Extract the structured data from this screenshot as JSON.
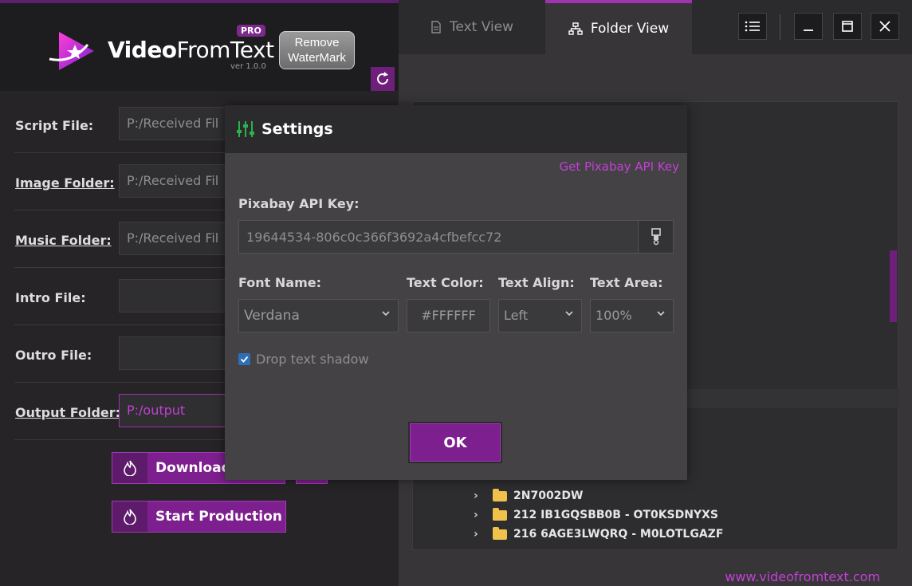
{
  "brand": {
    "name_bold": "Video",
    "name_rest": "FromText",
    "badge": "PRO",
    "version": "ver 1.0.0",
    "remove_watermark_line1": "Remove",
    "remove_watermark_line2": "WaterMark"
  },
  "form": {
    "script_file": {
      "label": "Script File:",
      "value": "P:/Received Fil"
    },
    "image_folder": {
      "label": "Image Folder:",
      "value": "P:/Received Fil"
    },
    "music_folder": {
      "label": "Music Folder:",
      "value": "P:/Received Fil"
    },
    "intro_file": {
      "label": "Intro File:",
      "value": ""
    },
    "outro_file": {
      "label": "Outro File:",
      "value": ""
    },
    "output_folder": {
      "label": "Output Folder:",
      "value": "P:/output"
    }
  },
  "actions": {
    "download": "Download",
    "start_production": "Start Production"
  },
  "tabs": [
    {
      "label": "Text View",
      "icon": "document-icon",
      "active": false
    },
    {
      "label": "Folder View",
      "icon": "sitemap-icon",
      "active": true
    }
  ],
  "tree": {
    "items": [
      {
        "label": "2N7002DW"
      },
      {
        "label": "212 IB1GQSBB0B - OT0KSDNYXS"
      },
      {
        "label": "216 6AGE3LWQRQ - M0LOTLGAZF"
      }
    ]
  },
  "footer": {
    "site": "www.videofromtext.com"
  },
  "settings": {
    "title": "Settings",
    "get_api_link": "Get Pixabay API Key",
    "api_label": "Pixabay API Key:",
    "api_value": "19644534-806c0c366f3692a4cfbefcc72",
    "font_name_label": "Font Name:",
    "font_name_value": "Verdana",
    "text_color_label": "Text Color:",
    "text_color_value": "#FFFFFF",
    "text_align_label": "Text Align:",
    "text_align_value": "Left",
    "text_area_label": "Text Area:",
    "text_area_value": "100%",
    "drop_shadow_label": "Drop text shadow",
    "drop_shadow_checked": true,
    "ok_label": "OK"
  },
  "colors": {
    "accent": "#7d1f8e",
    "link": "#c340d6",
    "folder": "#f0c24b",
    "checkbox": "#2d6fb5"
  }
}
